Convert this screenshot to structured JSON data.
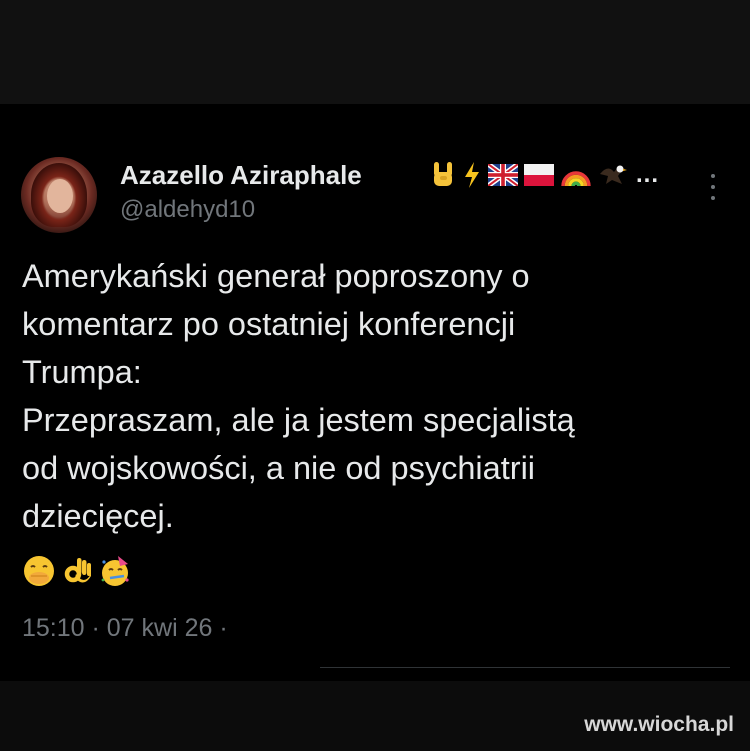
{
  "post": {
    "author": {
      "display_name": "Azazello Aziraphale",
      "handle": "@aldehyd10",
      "name_badges": [
        "rock-hand-emoji",
        "lightning-emoji",
        "uk-flag-emoji",
        "poland-flag-emoji",
        "rainbow-emoji",
        "eagle-emoji"
      ],
      "name_truncation": "..."
    },
    "text_lines": [
      "Amerykański generał poproszony o",
      "komentarz po ostatniej konferencji",
      "Trumpa:",
      "Przepraszam, ale ja jestem specjalistą",
      "od wojskowości, a nie od psychiatrii",
      "dziecięcej."
    ],
    "emojis": [
      "hand-over-mouth-emoji",
      "ok-hand-emoji",
      "partying-face-emoji"
    ],
    "timestamp": "15:10 · 07 kwi 26 ·",
    "more_icon": "more-options-icon"
  },
  "watermark": "www.wiocha.pl",
  "colors": {
    "background": "#000000",
    "text_primary": "#e7e9ea",
    "text_secondary": "#71767b",
    "divider": "#2f3336"
  }
}
